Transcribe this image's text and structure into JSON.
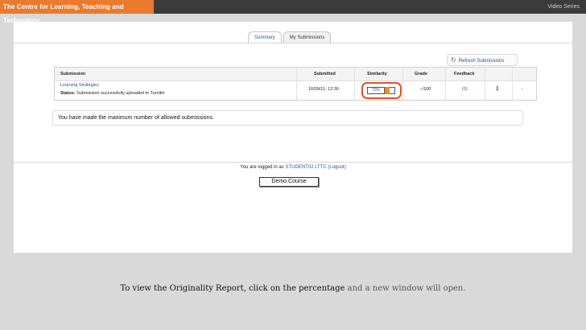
{
  "header": {
    "brand": "The Centre for Learning, Teaching and Technology",
    "series": "Video Series"
  },
  "tabs": [
    {
      "label": "Summary",
      "active": true
    },
    {
      "label": "My Submissions",
      "active": false
    }
  ],
  "refresh_label": "Refresh Submissions",
  "table": {
    "headers": [
      "Submission",
      "Submitted",
      "Similarity",
      "Grade",
      "Feedback"
    ],
    "row": {
      "title": "Learning Strategies",
      "status_label": "Status:",
      "status_text": "Submission successfully uploaded to Turnitin",
      "submitted": "16/09/11, 12:30",
      "similarity": "70%",
      "grade": "--/100",
      "feedback": "(0)",
      "last": "-"
    }
  },
  "notice": "You have made the maximum number of allowed submissions.",
  "login": {
    "prefix": "You are logged in as",
    "user": "STUDENT02 LTTC",
    "logout": "(Logout)"
  },
  "course_button": "Demo.Course",
  "caption": {
    "strong": "To view the Originality Report, click on the percentage",
    "light": "and a new window will open."
  },
  "colors": {
    "accent": "#e97a2e",
    "link": "#2954a3",
    "highlight": "#e2512a"
  }
}
